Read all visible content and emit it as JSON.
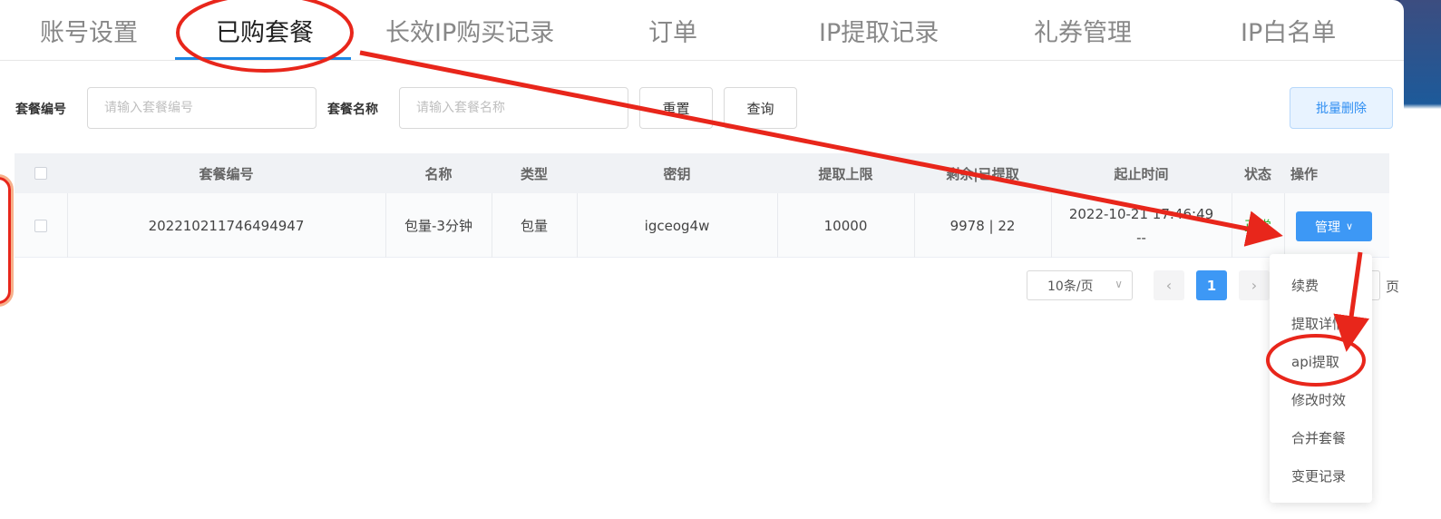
{
  "tabs": [
    {
      "label": "账号设置",
      "active": false
    },
    {
      "label": "已购套餐",
      "active": true
    },
    {
      "label": "长效IP购买记录",
      "active": false
    },
    {
      "label": "订单",
      "active": false
    },
    {
      "label": "IP提取记录",
      "active": false
    },
    {
      "label": "礼券管理",
      "active": false
    },
    {
      "label": "IP白名单",
      "active": false
    }
  ],
  "filters": {
    "package_no_label": "套餐编号",
    "package_no_placeholder": "请输入套餐编号",
    "package_name_label": "套餐名称",
    "package_name_placeholder": "请输入套餐名称",
    "reset_label": "重置",
    "query_label": "查询",
    "batch_delete_label": "批量删除"
  },
  "table": {
    "headers": [
      "套餐编号",
      "名称",
      "类型",
      "密钥",
      "提取上限",
      "剩余|已提取",
      "起止时间",
      "状态",
      "操作"
    ],
    "rows": [
      {
        "package_no": "20221021174649494​7",
        "name": "包量-3分钟",
        "type": "包量",
        "key": "igceog4w",
        "limit": "10000",
        "remaining_extracted": "9978 | 22",
        "start_time": "2022-10-21 17:46:49",
        "end_time": "--",
        "status": "正常",
        "action_label": "管理"
      }
    ]
  },
  "pagination": {
    "page_size": "10条/页",
    "current_page": "1",
    "unit": "页"
  },
  "dropdown": {
    "items": [
      "续费",
      "提取详情",
      "api提取",
      "修改时效",
      "合并套餐",
      "变更记录"
    ]
  },
  "colors": {
    "accent": "#3d98f5",
    "annotation": "#e8261b",
    "status_ok": "#2db52d"
  }
}
